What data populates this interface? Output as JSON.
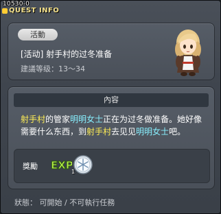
{
  "window": {
    "quest_id": "10530-0",
    "title": "QUEST INFO"
  },
  "summary": {
    "category_badge": "活動",
    "quest_name": "[活动] 射手村的过冬准备",
    "level_range": "建議等级：13～34"
  },
  "content": {
    "header": "內容",
    "description_parts": {
      "p1": "射手村",
      "p2": "的管家",
      "p3": "明明女士",
      "p4": "正在为过冬做准备。她好像需要什么东西，到",
      "p5": "射手村",
      "p6": "去见见",
      "p7": "明明女士",
      "p8": "吧。"
    },
    "reward": {
      "label": "獎勵",
      "exp_text": "EXP",
      "item_count": "1"
    }
  },
  "status": {
    "text": "狀態： 可開始 / 不可執行任務"
  },
  "colors": {
    "highlight_place": "#ffee55",
    "highlight_npc": "#88f0ff",
    "title_color": "#f3e08a"
  },
  "icons": {
    "npc": "npc-portrait-icon",
    "exp": "exp-icon",
    "reward_item": "snowflake-coin-icon"
  }
}
